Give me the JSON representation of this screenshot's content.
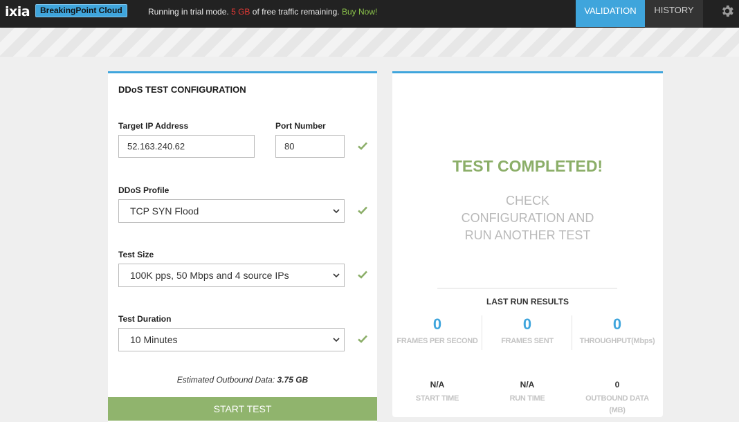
{
  "header": {
    "logo": "ixia",
    "product": "BreakingPoint Cloud",
    "trial_prefix": "Running in trial mode.",
    "trial_amount": "5 GB",
    "trial_suffix": "of free traffic remaining.",
    "buy_now": "Buy Now!",
    "tabs": [
      {
        "label": "VALIDATION",
        "active": true
      },
      {
        "label": "HISTORY",
        "active": false
      }
    ],
    "settings_icon": "gear-icon"
  },
  "config": {
    "title": "DDoS TEST CONFIGURATION",
    "target_ip_label": "Target IP Address",
    "target_ip_value": "52.163.240.62",
    "port_label": "Port Number",
    "port_value": "80",
    "profile_label": "DDoS Profile",
    "profile_value": "TCP SYN Flood",
    "size_label": "Test Size",
    "size_value": "100K pps, 50 Mbps and 4 source IPs",
    "duration_label": "Test Duration",
    "duration_value": "10 Minutes",
    "estimate_label": "Estimated Outbound Data:",
    "estimate_value": "3.75 GB",
    "start_button": "START TEST"
  },
  "results": {
    "status": "TEST COMPLETED!",
    "message_lines": [
      "CHECK",
      "CONFIGURATION AND",
      "RUN ANOTHER TEST"
    ],
    "last_run_title": "LAST RUN RESULTS",
    "frames_per_second": "0",
    "frames_per_second_label": "FRAMES PER SECOND",
    "frames_sent": "0",
    "frames_sent_label": "FRAMES SENT",
    "throughput": "0",
    "throughput_label": "THROUGHPUT(Mbps)",
    "start_time": "N/A",
    "start_time_label": "START TIME",
    "run_time": "N/A",
    "run_time_label": "RUN TIME",
    "outbound_data": "0",
    "outbound_data_label_1": "OUTBOUND DATA",
    "outbound_data_label_2": "(MB)"
  },
  "colors": {
    "accent": "#3fa5dc",
    "success": "#8bae68",
    "alert": "#e53935",
    "topbar": "#222222"
  }
}
